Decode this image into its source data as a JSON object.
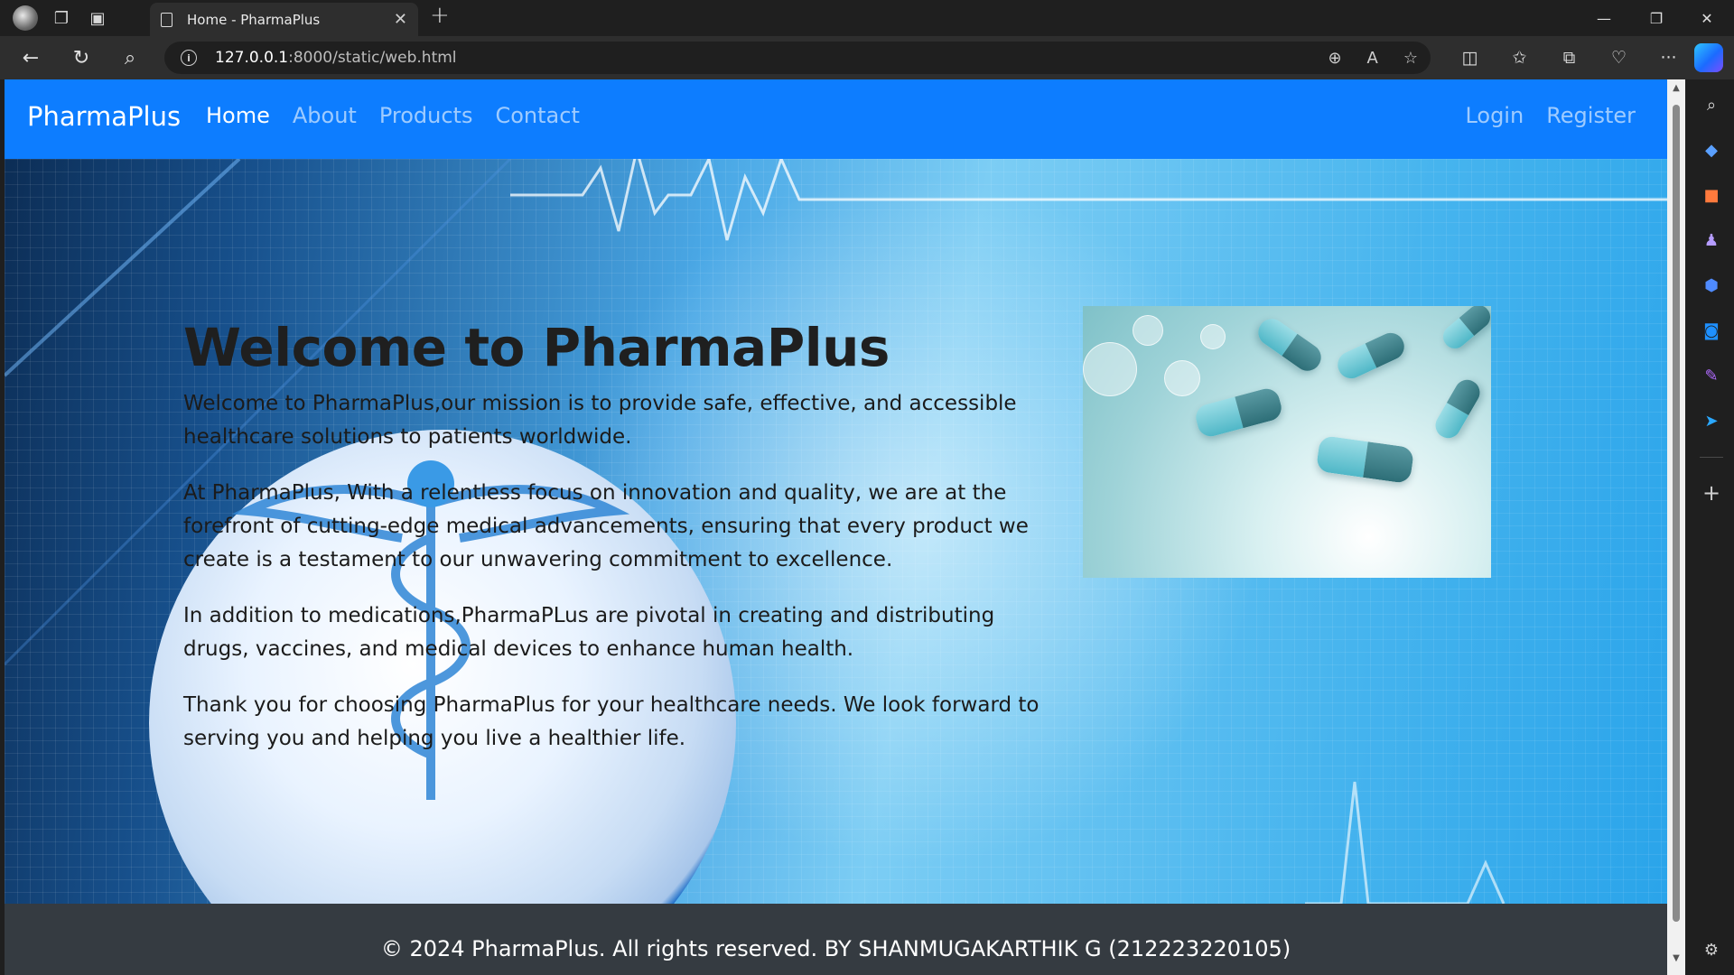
{
  "browser": {
    "tab_title": "Home - PharmaPlus",
    "url_host": "127.0.0.1",
    "url_rest": ":8000/static/web.html"
  },
  "site": {
    "brand": "PharmaPlus",
    "nav": [
      "Home",
      "About",
      "Products",
      "Contact"
    ],
    "active_nav": "Home",
    "auth": [
      "Login",
      "Register"
    ],
    "accent_color": "#0d7dff"
  },
  "hero": {
    "heading": "Welcome to PharmaPlus",
    "paragraphs": [
      "Welcome to PharmaPlus,our mission is to provide safe, effective, and accessible healthcare solutions to patients worldwide.",
      "At PharmaPlus, With a relentless focus on innovation and quality, we are at the forefront of cutting-edge medical advancements, ensuring that every product we create is a testament to our unwavering commitment to excellence.",
      "In addition to medications,PharmaPLus are pivotal in creating and distributing drugs, vaccines, and medical devices to enhance human health.",
      "Thank you for choosing PharmaPlus for your healthcare needs. We look forward to serving you and helping you live a healthier life."
    ]
  },
  "footer": {
    "text": "© 2024 PharmaPlus. All rights reserved. BY SHANMUGAKARTHIK G (212223220105)"
  }
}
